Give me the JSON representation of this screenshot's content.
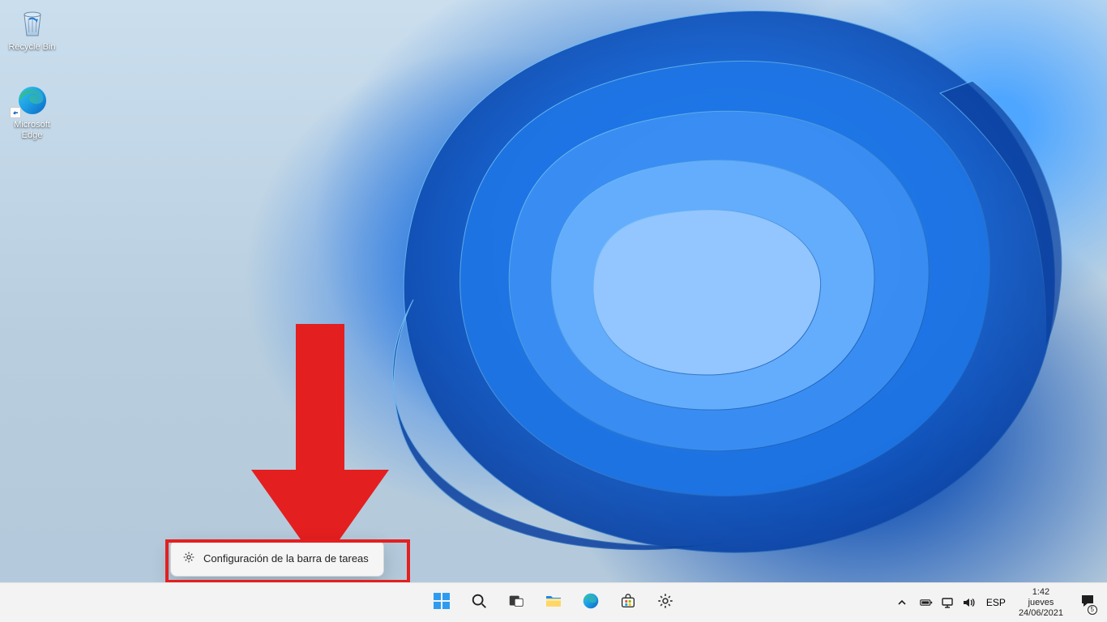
{
  "desktop": {
    "icons": [
      {
        "id": "recycle-bin",
        "label": "Recycle Bin"
      },
      {
        "id": "edge",
        "label": "Microsoft\nEdge"
      }
    ]
  },
  "context_menu": {
    "items": [
      {
        "id": "taskbar-settings",
        "label": "Configuración de la barra de tareas",
        "icon": "gear-icon"
      }
    ]
  },
  "taskbar": {
    "center_items": [
      {
        "id": "start",
        "name": "start-button",
        "icon": "windows-logo-icon"
      },
      {
        "id": "search",
        "name": "search-button",
        "icon": "search-icon"
      },
      {
        "id": "taskview",
        "name": "task-view-button",
        "icon": "task-view-icon"
      },
      {
        "id": "explorer",
        "name": "file-explorer-button",
        "icon": "file-explorer-icon"
      },
      {
        "id": "edge",
        "name": "edge-button",
        "icon": "edge-icon"
      },
      {
        "id": "store",
        "name": "store-button",
        "icon": "store-icon"
      },
      {
        "id": "settings",
        "name": "settings-button",
        "icon": "gear-icon"
      }
    ]
  },
  "tray": {
    "chevron": "chevron-up-icon",
    "battery": "battery-icon",
    "network": "network-icon",
    "volume": "volume-icon",
    "language": "ESP",
    "clock": {
      "time": "1:42",
      "day": "jueves",
      "date": "24/06/2021"
    },
    "notifications_badge": "5"
  },
  "annotation": {
    "arrow_color": "#e41f1f",
    "highlight_color": "#e41f1f"
  }
}
